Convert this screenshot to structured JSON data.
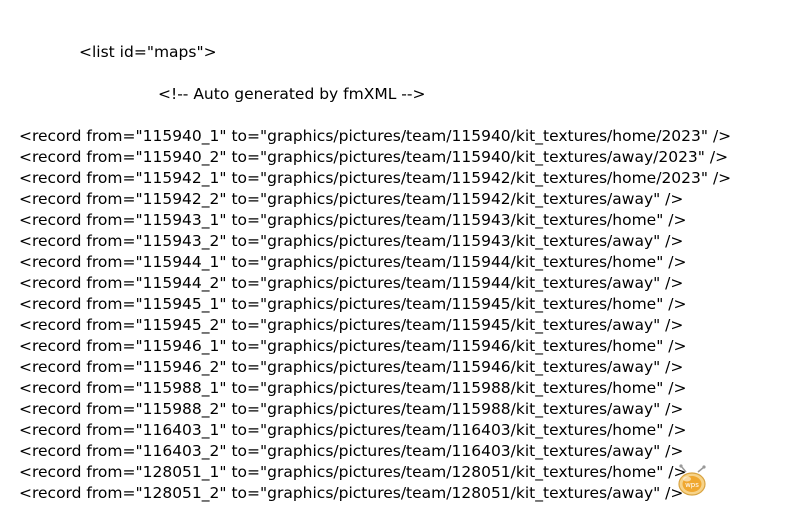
{
  "document": {
    "list_open_tag": "<list id=\"maps\">",
    "comment": "<!-- Auto generated by fmXML -->",
    "records": [
      "<record from=\"115940_1\" to=\"graphics/pictures/team/115940/kit_textures/home/2023\" />",
      "<record from=\"115940_2\" to=\"graphics/pictures/team/115940/kit_textures/away/2023\" />",
      "<record from=\"115942_1\" to=\"graphics/pictures/team/115942/kit_textures/home/2023\" />",
      "<record from=\"115942_2\" to=\"graphics/pictures/team/115942/kit_textures/away\" />",
      "<record from=\"115943_1\" to=\"graphics/pictures/team/115943/kit_textures/home\" />",
      "<record from=\"115943_2\" to=\"graphics/pictures/team/115943/kit_textures/away\" />",
      "<record from=\"115944_1\" to=\"graphics/pictures/team/115944/kit_textures/home\" />",
      "<record from=\"115944_2\" to=\"graphics/pictures/team/115944/kit_textures/away\" />",
      "<record from=\"115945_1\" to=\"graphics/pictures/team/115945/kit_textures/home\" />",
      "<record from=\"115945_2\" to=\"graphics/pictures/team/115945/kit_textures/away\" />",
      "<record from=\"115946_1\" to=\"graphics/pictures/team/115946/kit_textures/home\" />",
      "<record from=\"115946_2\" to=\"graphics/pictures/team/115946/kit_textures/away\" />",
      "<record from=\"115988_1\" to=\"graphics/pictures/team/115988/kit_textures/home\" />",
      "<record from=\"115988_2\" to=\"graphics/pictures/team/115988/kit_textures/away\" />",
      "<record from=\"116403_1\" to=\"graphics/pictures/team/116403/kit_textures/home\" />",
      "<record from=\"116403_2\" to=\"graphics/pictures/team/116403/kit_textures/away\" />",
      "<record from=\"128051_1\" to=\"graphics/pictures/team/128051/kit_textures/home\" />",
      "<record from=\"128051_2\" to=\"graphics/pictures/team/128051/kit_textures/away\" />"
    ]
  },
  "wps_icon": {
    "icon": "wps-assistant-icon",
    "label": "wps",
    "color": "#f0a830"
  }
}
